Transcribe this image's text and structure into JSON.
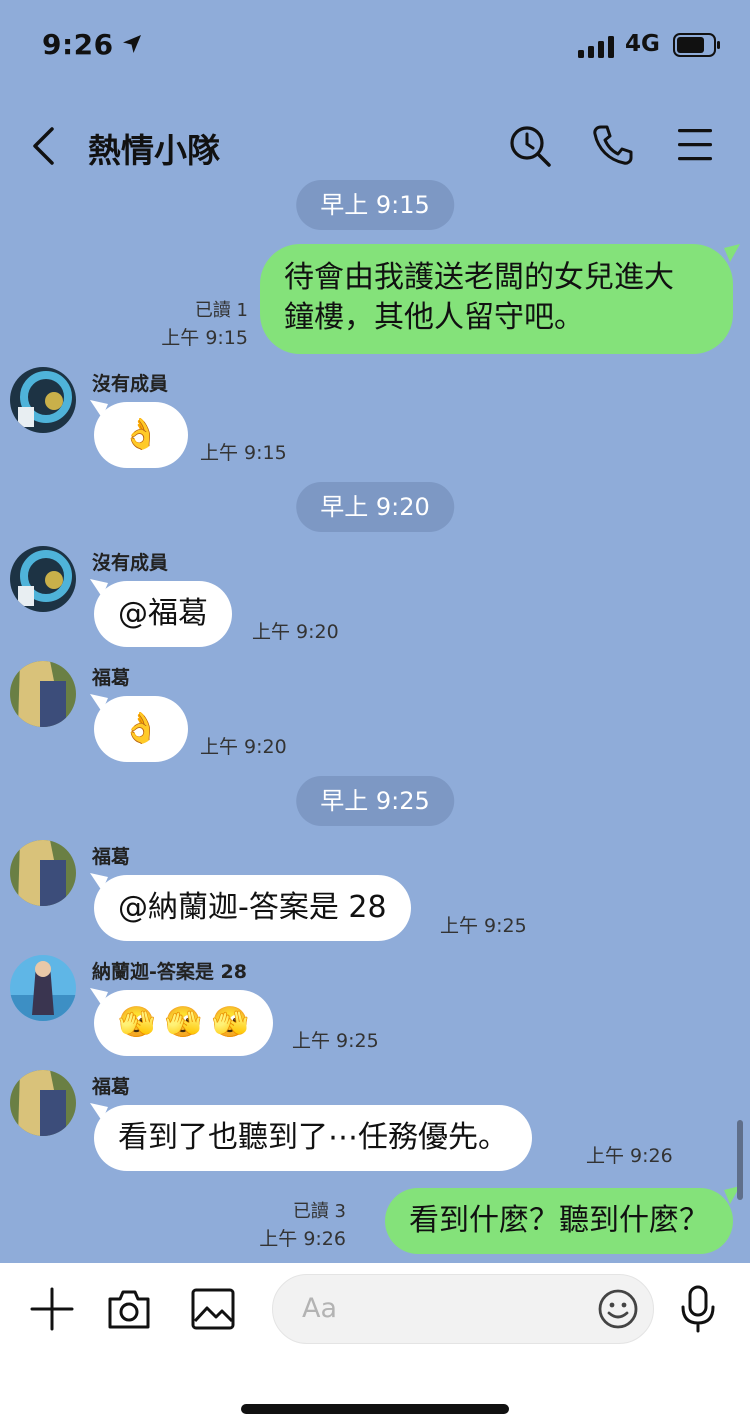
{
  "status_bar": {
    "time": "9:26",
    "network": "4G"
  },
  "header": {
    "title": "熱情小隊"
  },
  "date_pills": [
    "早上 9:15",
    "早上 9:20",
    "早上 9:25"
  ],
  "messages": [
    {
      "direction": "out",
      "lines": [
        "待會由我護送老闆的女兒進大",
        "鐘樓，其他人留守吧。"
      ],
      "read": "已讀 1",
      "time": "上午 9:15"
    },
    {
      "direction": "in",
      "sender": "沒有成員",
      "text": "👌",
      "time": "上午 9:15"
    },
    {
      "direction": "in",
      "sender": "沒有成員",
      "text": "@福葛",
      "time": "上午 9:20"
    },
    {
      "direction": "in",
      "sender": "福葛",
      "text": "👌",
      "time": "上午 9:20"
    },
    {
      "direction": "in",
      "sender": "福葛",
      "text": "@納蘭迦-答案是 28",
      "time": "上午 9:25"
    },
    {
      "direction": "in",
      "sender": "納蘭迦-答案是 28",
      "text": "🫣 🫣 🫣",
      "time": "上午 9:25"
    },
    {
      "direction": "in",
      "sender": "福葛",
      "text": "看到了也聽到了⋯任務優先。",
      "time": "上午 9:26"
    },
    {
      "direction": "out",
      "text": "看到什麼？聽到什麼？",
      "read": "已讀 3",
      "time": "上午 9:26"
    }
  ],
  "input": {
    "placeholder": "Aa"
  },
  "icons": [
    "location-arrow-icon",
    "signal-icon",
    "battery-icon",
    "back-icon",
    "search-icon",
    "phone-icon",
    "menu-icon",
    "plus-icon",
    "camera-icon",
    "image-icon",
    "emoji-icon",
    "microphone-icon"
  ],
  "colors": {
    "background": "#8facd9",
    "outgoing_bubble": "#84e27a",
    "incoming_bubble": "#ffffff",
    "date_pill": "#7d98c4"
  }
}
